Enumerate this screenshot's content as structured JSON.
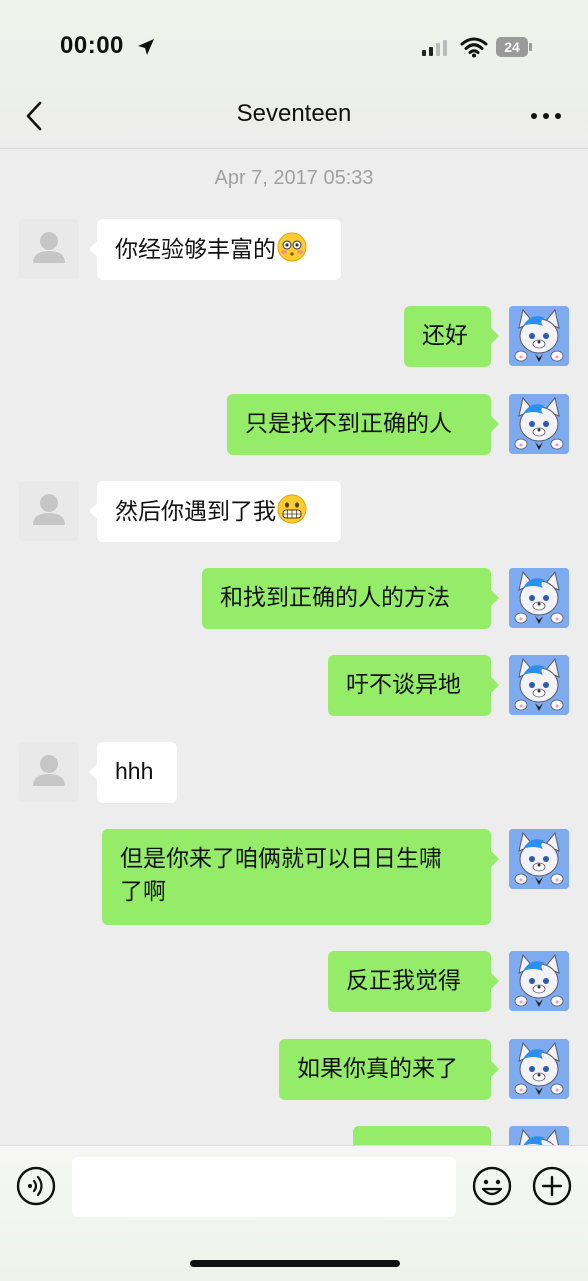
{
  "status_bar": {
    "time": "00:00",
    "battery": "24"
  },
  "header": {
    "title": "Seventeen"
  },
  "timestamp": "Apr 7, 2017 05:33",
  "messages": [
    {
      "side": "left",
      "text": "你经验够丰富的",
      "emoji": "flushed-face"
    },
    {
      "side": "right",
      "text": "还好"
    },
    {
      "side": "right",
      "text": "只是找不到正确的人"
    },
    {
      "side": "left",
      "text": "然后你遇到了我",
      "emoji": "grimacing-face"
    },
    {
      "side": "right",
      "text": "和找到正确的人的方法"
    },
    {
      "side": "right",
      "text": "吁不谈异地"
    },
    {
      "side": "left",
      "text": "hhh"
    },
    {
      "side": "right",
      "line1": "但是你来了咱俩就可以日日生啸",
      "line2": "了啊"
    },
    {
      "side": "right",
      "text": "反正我觉得"
    },
    {
      "side": "right",
      "text": "如果你真的来了"
    }
  ],
  "input": {
    "value": "",
    "placeholder": ""
  },
  "colors": {
    "sent_bubble": "#95ec69",
    "received_bubble": "#ffffff",
    "background": "#ededed"
  },
  "icons": {
    "voice": "voice-icon",
    "emoji": "emoji-icon",
    "more": "plus-icon",
    "back": "chevron-left-icon",
    "menu": "more-dots-icon"
  }
}
